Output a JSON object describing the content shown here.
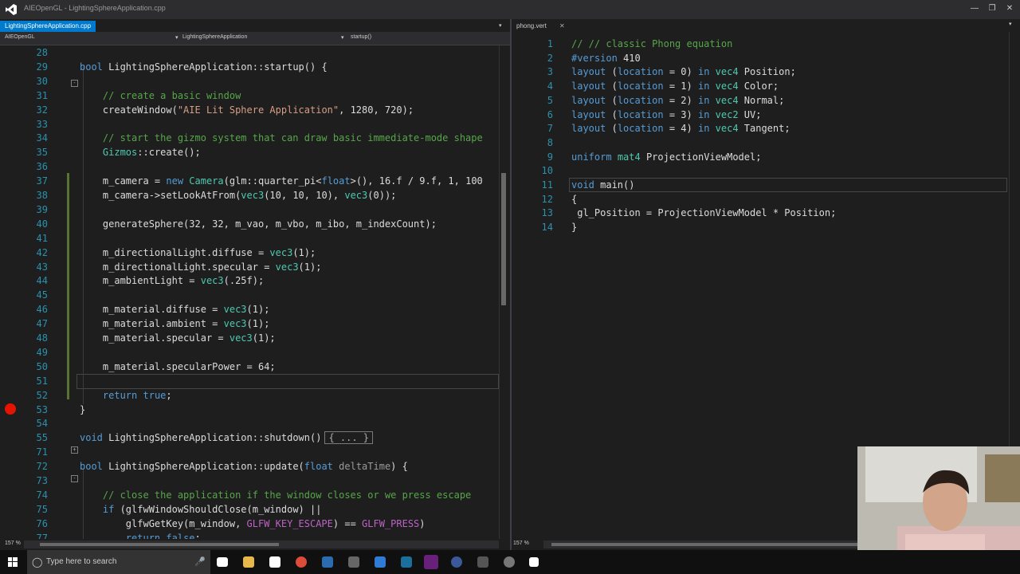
{
  "window": {
    "title": "AIEOpenGL - LightingSphereApplication.cpp"
  },
  "left_editor": {
    "tab_label": "LightingSphereApplication.cpp",
    "nav_project": "AIEOpenGL",
    "nav_class": "LightingSphereApplication",
    "nav_member": "startup()",
    "zoom": "157 %",
    "lines": [
      {
        "n": "28",
        "t": ""
      },
      {
        "n": "29",
        "t": "bool LightingSphereApplication::startup() {"
      },
      {
        "n": "30",
        "t": ""
      },
      {
        "n": "31",
        "t": "    // create a basic window"
      },
      {
        "n": "32",
        "t": "    createWindow(\"AIE Lit Sphere Application\", 1280, 720);"
      },
      {
        "n": "33",
        "t": ""
      },
      {
        "n": "34",
        "t": "    // start the gizmo system that can draw basic immediate-mode shape"
      },
      {
        "n": "35",
        "t": "    Gizmos::create();"
      },
      {
        "n": "36",
        "t": ""
      },
      {
        "n": "37",
        "t": "    m_camera = new Camera(glm::quarter_pi<float>(), 16.f / 9.f, 1, 100"
      },
      {
        "n": "38",
        "t": "    m_camera->setLookAtFrom(vec3(10, 10, 10), vec3(0));"
      },
      {
        "n": "39",
        "t": ""
      },
      {
        "n": "40",
        "t": "    generateSphere(32, 32, m_vao, m_vbo, m_ibo, m_indexCount);"
      },
      {
        "n": "41",
        "t": ""
      },
      {
        "n": "42",
        "t": "    m_directionalLight.diffuse = vec3(1);"
      },
      {
        "n": "43",
        "t": "    m_directionalLight.specular = vec3(1);"
      },
      {
        "n": "44",
        "t": "    m_ambientLight = vec3(.25f);"
      },
      {
        "n": "45",
        "t": ""
      },
      {
        "n": "46",
        "t": "    m_material.diffuse = vec3(1);"
      },
      {
        "n": "47",
        "t": "    m_material.ambient = vec3(1);"
      },
      {
        "n": "48",
        "t": "    m_material.specular = vec3(1);"
      },
      {
        "n": "49",
        "t": ""
      },
      {
        "n": "50",
        "t": "    m_material.specularPower = 64;"
      },
      {
        "n": "51",
        "t": ""
      },
      {
        "n": "52",
        "t": "    return true;"
      },
      {
        "n": "53",
        "t": "}"
      },
      {
        "n": "54",
        "t": ""
      },
      {
        "n": "55",
        "t": "void LightingSphereApplication::shutdown()"
      },
      {
        "n": "71",
        "t": ""
      },
      {
        "n": "72",
        "t": "bool LightingSphereApplication::update(float deltaTime) {"
      },
      {
        "n": "73",
        "t": ""
      },
      {
        "n": "74",
        "t": "    // close the application if the window closes or we press escape"
      },
      {
        "n": "75",
        "t": "    if (glfwWindowShouldClose(m_window) ||"
      },
      {
        "n": "76",
        "t": "        glfwGetKey(m_window, GLFW_KEY_ESCAPE) == GLFW_PRESS)"
      },
      {
        "n": "77",
        "t": "        return false;"
      }
    ],
    "collapsed_label": "{ ... }"
  },
  "right_editor": {
    "tab_label": "phong.vert",
    "zoom": "157 %",
    "lines": [
      {
        "n": "1",
        "t": "// // classic Phong equation"
      },
      {
        "n": "2",
        "t": "#version 410"
      },
      {
        "n": "3",
        "t": "layout (location = 0) in vec4 Position;"
      },
      {
        "n": "4",
        "t": "layout (location = 1) in vec4 Color;"
      },
      {
        "n": "5",
        "t": "layout (location = 2) in vec4 Normal;"
      },
      {
        "n": "6",
        "t": "layout (location = 3) in vec2 UV;"
      },
      {
        "n": "7",
        "t": "layout (location = 4) in vec4 Tangent;"
      },
      {
        "n": "8",
        "t": ""
      },
      {
        "n": "9",
        "t": "uniform mat4 ProjectionViewModel;"
      },
      {
        "n": "10",
        "t": ""
      },
      {
        "n": "11",
        "t": "void main()"
      },
      {
        "n": "12",
        "t": "{"
      },
      {
        "n": "13",
        "t": " gl_Position = ProjectionViewModel * Position;"
      },
      {
        "n": "14",
        "t": "}"
      }
    ]
  },
  "taskbar": {
    "search_placeholder": "Type here to search"
  },
  "colors": {
    "accent": "#007acc",
    "breakpoint": "#e51400",
    "keyword": "#569cd6",
    "comment": "#57a64a",
    "string": "#d69d85",
    "type": "#4ec9b0"
  }
}
